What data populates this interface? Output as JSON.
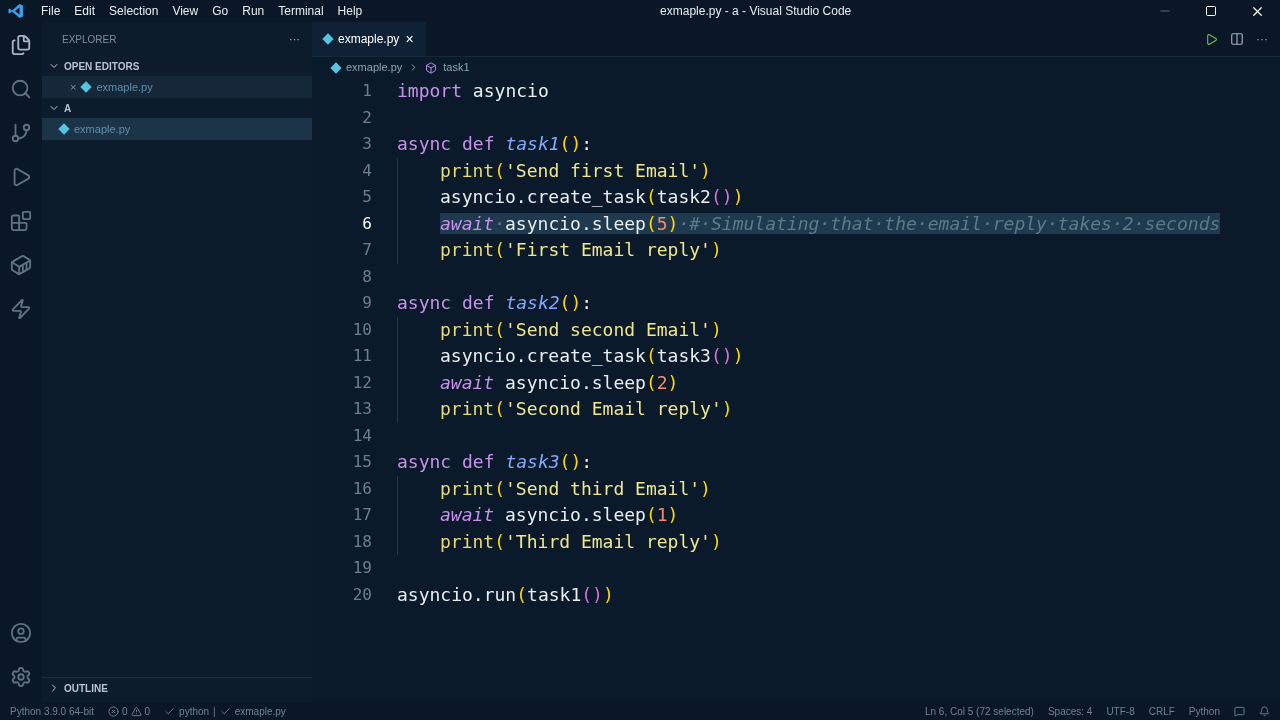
{
  "window": {
    "title": "exmaple.py - a - Visual Studio Code"
  },
  "menu": [
    "File",
    "Edit",
    "Selection",
    "View",
    "Go",
    "Run",
    "Terminal",
    "Help"
  ],
  "sidebar": {
    "title": "EXPLORER",
    "more": "···",
    "sections": [
      {
        "label": "OPEN EDITORS",
        "expanded": true,
        "items": [
          {
            "label": "exmaple.py",
            "close": "×",
            "selected": false
          }
        ]
      },
      {
        "label": "A",
        "expanded": true,
        "items": [
          {
            "label": "exmaple.py",
            "selected": true
          }
        ]
      },
      {
        "label": "OUTLINE",
        "expanded": false
      }
    ]
  },
  "tabs": [
    {
      "label": "exmaple.py",
      "close": "×",
      "selected": true
    }
  ],
  "breadcrumbs": [
    "exmaple.py",
    "task1"
  ],
  "code": [
    {
      "number": "1",
      "selected": false,
      "indented": false,
      "tokens": [
        {
          "kind": "keyword",
          "text": "import"
        },
        {
          "kind": "plain",
          "text": " asyncio"
        }
      ]
    },
    {
      "number": "2",
      "selected": false
    },
    {
      "number": "3",
      "selected": false,
      "indented": false,
      "tokens": [
        {
          "kind": "keyword",
          "text": "async def "
        },
        {
          "kind": "func",
          "text": "task1"
        },
        {
          "kind": "paren1",
          "text": "()"
        },
        {
          "kind": "plain",
          "text": ":"
        }
      ]
    },
    {
      "number": "4",
      "selected": false,
      "indented": true,
      "tokens": [
        {
          "kind": "builtin",
          "text": "print"
        },
        {
          "kind": "paren1",
          "text": "("
        },
        {
          "kind": "string",
          "text": "'Send first Email'"
        },
        {
          "kind": "paren1",
          "text": ")"
        }
      ]
    },
    {
      "number": "5",
      "selected": false,
      "indented": true,
      "tokens": [
        {
          "kind": "plain",
          "text": "asyncio.create_task"
        },
        {
          "kind": "paren1",
          "text": "("
        },
        {
          "kind": "plain",
          "text": "task2"
        },
        {
          "kind": "paren2",
          "text": "()"
        },
        {
          "kind": "paren1",
          "text": ")"
        }
      ]
    },
    {
      "number": "6",
      "selected": true,
      "indented": true,
      "tokens": [
        {
          "kind": "control",
          "text": "await"
        },
        {
          "kind": "comment",
          "text": "·"
        },
        {
          "kind": "plain",
          "text": "asyncio.sleep"
        },
        {
          "kind": "paren1",
          "text": "("
        },
        {
          "kind": "number",
          "text": "5"
        },
        {
          "kind": "paren1",
          "text": ")"
        },
        {
          "kind": "comment",
          "text": "·#·Simulating·that·the·email·reply·takes·2·seconds"
        }
      ]
    },
    {
      "number": "7",
      "selected": false,
      "indented": true,
      "tokens": [
        {
          "kind": "builtin",
          "text": "print"
        },
        {
          "kind": "paren1",
          "text": "("
        },
        {
          "kind": "string",
          "text": "'First Email reply'"
        },
        {
          "kind": "paren1",
          "text": ")"
        }
      ]
    },
    {
      "number": "8",
      "selected": false
    },
    {
      "number": "9",
      "selected": false,
      "indented": false,
      "tokens": [
        {
          "kind": "keyword",
          "text": "async def "
        },
        {
          "kind": "func",
          "text": "task2"
        },
        {
          "kind": "paren1",
          "text": "()"
        },
        {
          "kind": "plain",
          "text": ":"
        }
      ]
    },
    {
      "number": "10",
      "selected": false,
      "indented": true,
      "tokens": [
        {
          "kind": "builtin",
          "text": "print"
        },
        {
          "kind": "paren1",
          "text": "("
        },
        {
          "kind": "string",
          "text": "'Send second Email'"
        },
        {
          "kind": "paren1",
          "text": ")"
        }
      ]
    },
    {
      "number": "11",
      "selected": false,
      "indented": true,
      "tokens": [
        {
          "kind": "plain",
          "text": "asyncio.create_task"
        },
        {
          "kind": "paren1",
          "text": "("
        },
        {
          "kind": "plain",
          "text": "task3"
        },
        {
          "kind": "paren2",
          "text": "()"
        },
        {
          "kind": "paren1",
          "text": ")"
        }
      ]
    },
    {
      "number": "12",
      "selected": false,
      "indented": true,
      "tokens": [
        {
          "kind": "control",
          "text": "await"
        },
        {
          "kind": "plain",
          "text": " asyncio.sleep"
        },
        {
          "kind": "paren1",
          "text": "("
        },
        {
          "kind": "number",
          "text": "2"
        },
        {
          "kind": "paren1",
          "text": ")"
        }
      ]
    },
    {
      "number": "13",
      "selected": false,
      "indented": true,
      "tokens": [
        {
          "kind": "builtin",
          "text": "print"
        },
        {
          "kind": "paren1",
          "text": "("
        },
        {
          "kind": "string",
          "text": "'Second Email reply'"
        },
        {
          "kind": "paren1",
          "text": ")"
        }
      ]
    },
    {
      "number": "14",
      "selected": false
    },
    {
      "number": "15",
      "selected": false,
      "indented": false,
      "tokens": [
        {
          "kind": "keyword",
          "text": "async def "
        },
        {
          "kind": "func",
          "text": "task3"
        },
        {
          "kind": "paren1",
          "text": "()"
        },
        {
          "kind": "plain",
          "text": ":"
        }
      ]
    },
    {
      "number": "16",
      "selected": false,
      "indented": true,
      "tokens": [
        {
          "kind": "builtin",
          "text": "print"
        },
        {
          "kind": "paren1",
          "text": "("
        },
        {
          "kind": "string",
          "text": "'Send third Email'"
        },
        {
          "kind": "paren1",
          "text": ")"
        }
      ]
    },
    {
      "number": "17",
      "selected": false,
      "indented": true,
      "tokens": [
        {
          "kind": "control",
          "text": "await"
        },
        {
          "kind": "plain",
          "text": " asyncio.sleep"
        },
        {
          "kind": "paren1",
          "text": "("
        },
        {
          "kind": "number",
          "text": "1"
        },
        {
          "kind": "paren1",
          "text": ")"
        }
      ]
    },
    {
      "number": "18",
      "selected": false,
      "indented": true,
      "tokens": [
        {
          "kind": "builtin",
          "text": "print"
        },
        {
          "kind": "paren1",
          "text": "("
        },
        {
          "kind": "string",
          "text": "'Third Email reply'"
        },
        {
          "kind": "paren1",
          "text": ")"
        }
      ]
    },
    {
      "number": "19",
      "selected": false
    },
    {
      "number": "20",
      "selected": false,
      "indented": false,
      "tokens": [
        {
          "kind": "plain",
          "text": "asyncio.run"
        },
        {
          "kind": "paren1",
          "text": "("
        },
        {
          "kind": "plain",
          "text": "task1"
        },
        {
          "kind": "paren2",
          "text": "()"
        },
        {
          "kind": "paren1",
          "text": ")"
        }
      ]
    }
  ],
  "status_bar": {
    "interpreter": "Python 3.9.0 64-bit",
    "errors": "0",
    "warnings": "0",
    "checks": [
      "python",
      "exmaple.py"
    ],
    "separator": "|",
    "right": [
      "Ln 6, Col 5 (72 selected)",
      "Spaces: 4",
      "UTF-8",
      "CRLF",
      "Python"
    ]
  }
}
